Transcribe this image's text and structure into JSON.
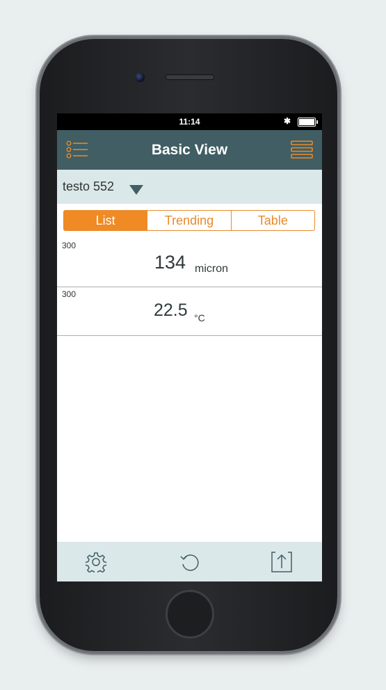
{
  "status_bar": {
    "time": "11:14",
    "bluetooth": "✱"
  },
  "navbar": {
    "title": "Basic View"
  },
  "device": {
    "name": "testo 552"
  },
  "tabs": [
    {
      "label": "List",
      "active": true
    },
    {
      "label": "Trending",
      "active": false
    },
    {
      "label": "Table",
      "active": false
    }
  ],
  "readings": [
    {
      "channel": "300",
      "value": "134",
      "unit": "micron"
    },
    {
      "channel": "300",
      "value": "22.5",
      "unit": "°C"
    }
  ],
  "colors": {
    "accent": "#f08a24",
    "navbar": "#405e64",
    "panel": "#dbe8e9"
  },
  "icons": {
    "left": "list-icon",
    "right": "menu-icon",
    "tool1": "gear-icon",
    "tool2": "refresh-icon",
    "tool3": "export-icon"
  }
}
